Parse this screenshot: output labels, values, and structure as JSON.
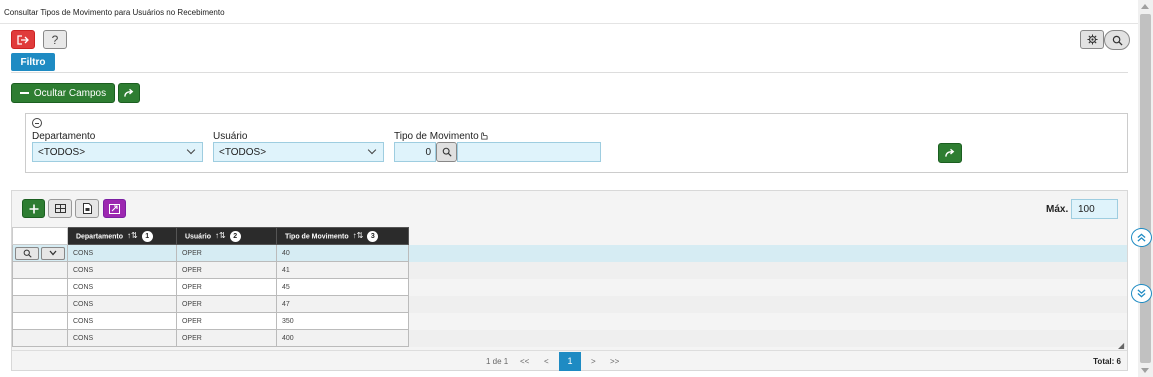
{
  "window": {
    "title": "Consultar Tipos de Movimento para Usuários no Recebimento"
  },
  "toolbar": {
    "filter_label": "Filtro",
    "help_label": "?"
  },
  "actions": {
    "hide_fields_label": "Ocultar Campos"
  },
  "filters": {
    "departamento": {
      "label": "Departamento",
      "value": "<TODOS>"
    },
    "usuario": {
      "label": "Usuário",
      "value": "<TODOS>"
    },
    "tipo_movimento": {
      "label": "Tipo de Movimento",
      "value": "0",
      "description": ""
    }
  },
  "grid": {
    "max_label": "Máx.",
    "max_value": "100",
    "columns": [
      {
        "label": "Departamento",
        "order": "1"
      },
      {
        "label": "Usuário",
        "order": "2"
      },
      {
        "label": "Tipo de Movimento",
        "order": "3"
      }
    ],
    "rows": [
      [
        "CONS",
        "OPER",
        "40"
      ],
      [
        "CONS",
        "OPER",
        "41"
      ],
      [
        "CONS",
        "OPER",
        "45"
      ],
      [
        "CONS",
        "OPER",
        "47"
      ],
      [
        "CONS",
        "OPER",
        "350"
      ],
      [
        "CONS",
        "OPER",
        "400"
      ]
    ]
  },
  "pager": {
    "page_info": "1 de 1",
    "first": "<<",
    "prev": "<",
    "current": "1",
    "next": ">",
    "last": ">>",
    "total": "Total: 6"
  },
  "colors": {
    "accent": "#1e8bc3",
    "success": "#2e7d32",
    "danger": "#e03b3b",
    "purple": "#9c27b0",
    "input_bg": "#dff3fb"
  }
}
